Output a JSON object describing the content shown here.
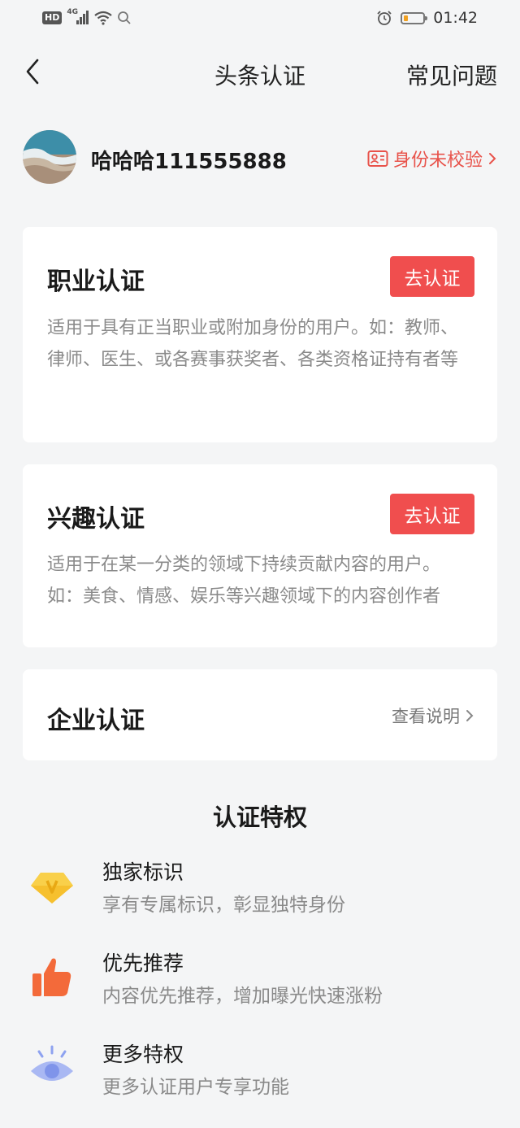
{
  "status_bar": {
    "hd": "HD",
    "network": "4G",
    "time": "01:42",
    "battery_level": 0.2
  },
  "nav": {
    "title": "头条认证",
    "faq": "常见问题"
  },
  "profile": {
    "username": "哈哈哈111555888",
    "id_status": "身份未校验"
  },
  "cards": {
    "professional": {
      "title": "职业认证",
      "button": "去认证",
      "desc": "适用于具有正当职业或附加身份的用户。如：教师、律师、医生、或各赛事获奖者、各类资格证持有者等"
    },
    "interest": {
      "title": "兴趣认证",
      "button": "去认证",
      "desc": "适用于在某一分类的领域下持续贡献内容的用户。如：美食、情感、娱乐等兴趣领域下的内容创作者"
    },
    "enterprise": {
      "title": "企业认证",
      "link": "查看说明"
    }
  },
  "privileges": {
    "title": "认证特权",
    "items": [
      {
        "name": "独家标识",
        "desc": "享有专属标识，彰显独特身份",
        "icon": "v-badge-icon"
      },
      {
        "name": "优先推荐",
        "desc": "内容优先推荐，增加曝光快速涨粉",
        "icon": "thumbs-up-icon"
      },
      {
        "name": "更多特权",
        "desc": "更多认证用户专享功能",
        "icon": "eye-icon"
      }
    ]
  },
  "colors": {
    "accent_red": "#f04e4e",
    "status_red": "#e8524a",
    "badge_gold": "#f6c02e",
    "thumb_orange": "#f36a3a",
    "eye_blue": "#8ea2f0"
  }
}
